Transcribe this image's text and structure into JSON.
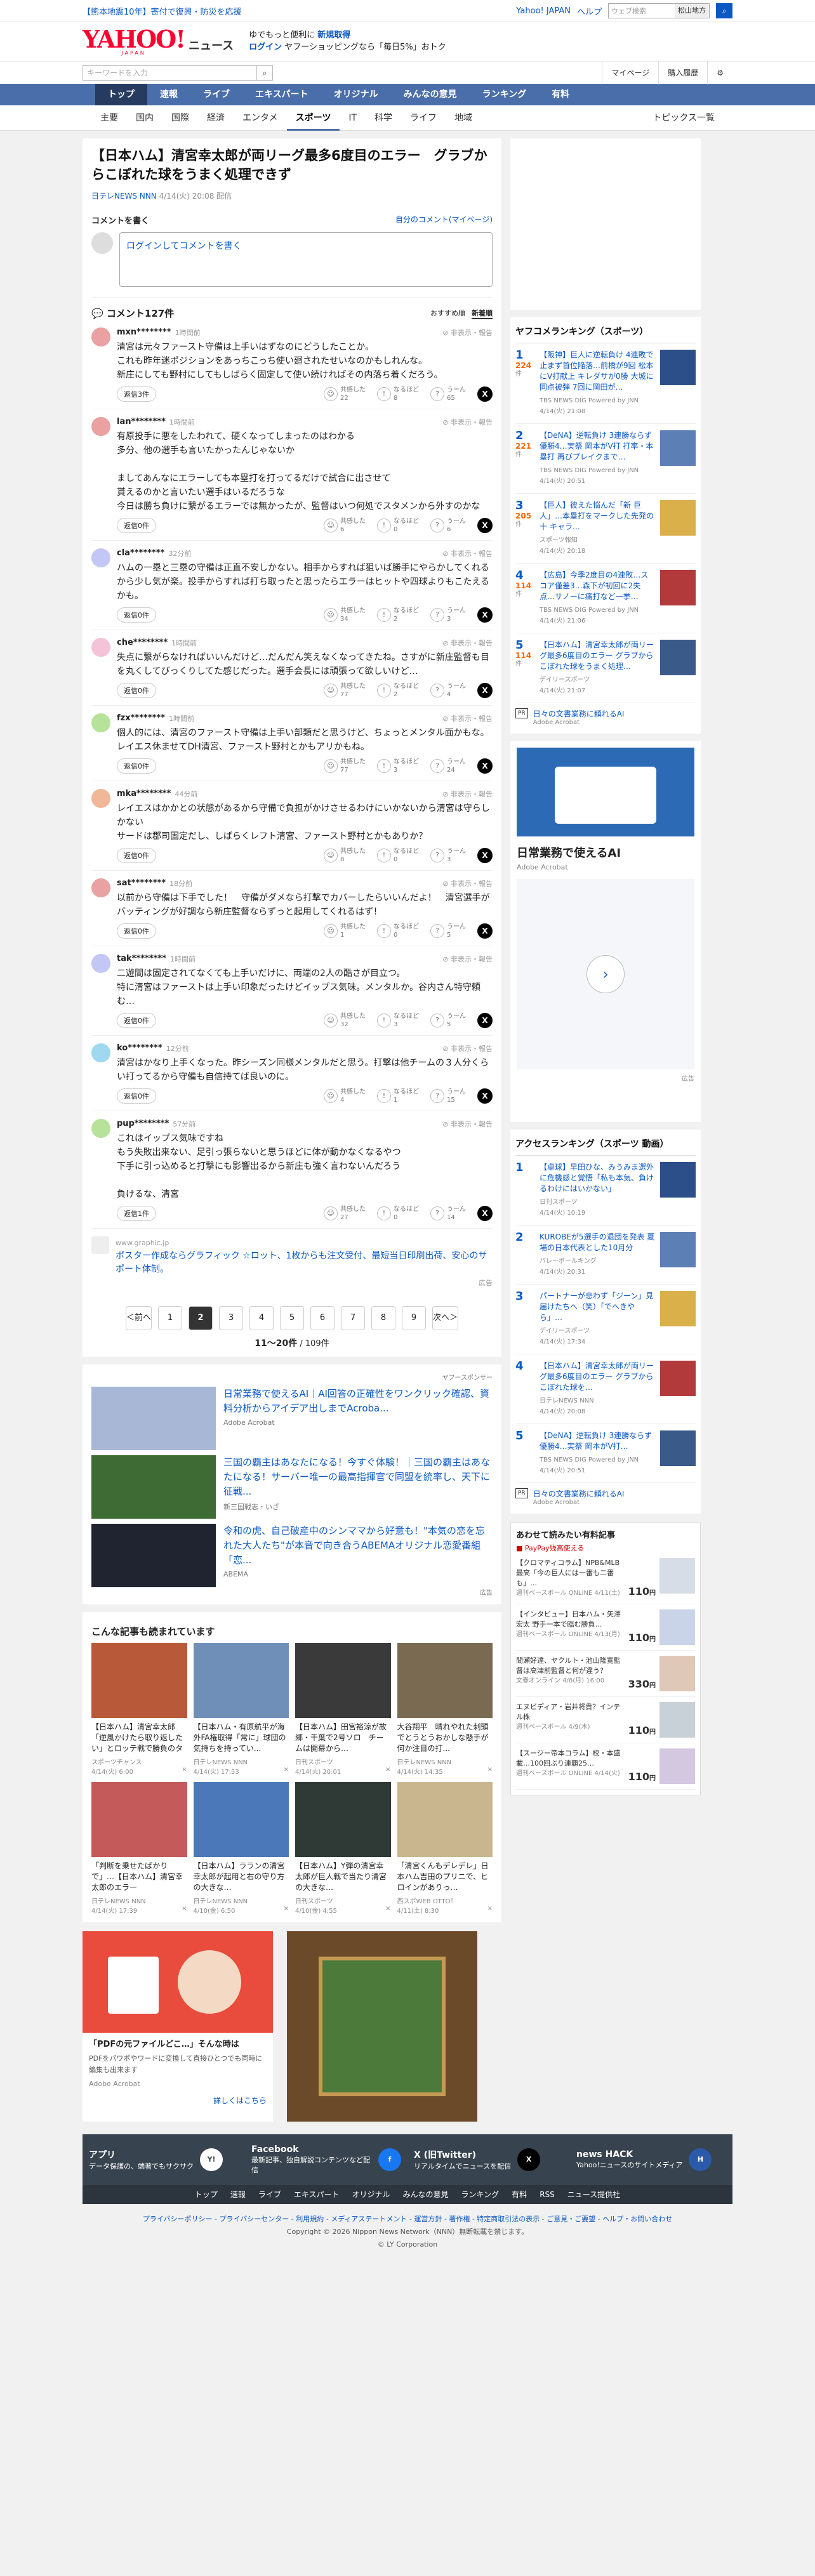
{
  "topbar": {
    "left": "【熊本地震10年】寄付で復興・防災を応援",
    "right": [
      "Yahoo! JAPAN",
      "ヘルプ"
    ],
    "search_placeholder": "ウェブ検索",
    "city": "松山地方"
  },
  "header": {
    "logo": "YAHOO!",
    "logo_sub": "JAPAN",
    "news": "ニュース",
    "promo1": "ゆでもっと便利に",
    "promo1b": "新規取得",
    "promo2": "ログイン",
    "promo2b": "ヤフーショッピングなら「毎日5%」おトク"
  },
  "searchrow": {
    "placeholder": "キーワードを入力",
    "util": [
      "マイページ",
      "購入履歴"
    ]
  },
  "nav1": [
    "トップ",
    "速報",
    "ライブ",
    "エキスパート",
    "オリジナル",
    "みんなの意見",
    "ランキング",
    "有料"
  ],
  "nav2": [
    "主要",
    "国内",
    "国際",
    "経済",
    "エンタメ",
    "スポーツ",
    "IT",
    "科学",
    "ライフ",
    "地域"
  ],
  "nav2_right": "トピックス一覧",
  "article": {
    "title": "【日本ハム】清宮幸太郎が両リーグ最多6度目のエラー　グラブからこぼれた球をうまく処理できず",
    "source": "日テレNEWS NNN",
    "date": "4/14(火) 20:08 配信"
  },
  "compose": {
    "heading": "コメントを書く",
    "mine": "自分のコメント(マイページ)",
    "prompt": "ログインしてコメントを書く"
  },
  "comments_head": {
    "count": "コメント127件",
    "sort1": "おすすめ順",
    "sort2": "新着順"
  },
  "reaction_labels": [
    "共感した",
    "なるほど",
    "うーん"
  ],
  "comments": [
    {
      "user": "mxn********",
      "time": "1時間前",
      "text": "清宮は元々ファースト守備は上手いはずなのにどうしたことか。\nこれも昨年迷ポジションをあっちこっち使い廻されたせいなのかもしれんな。\n新庄にしても野村にしてもしばらく固定して使い続ければその内落ち着くだろう。",
      "reply": "返信3件",
      "r": [
        22,
        8,
        65
      ],
      "av": "#e9a1a1"
    },
    {
      "user": "lan********",
      "time": "1時間前",
      "text": "有原投手に悪をしたわれて、硬くなってしまったのはわかる\n多分、他の選手も言いたかったんじゃないか\n\nましてあんなにエラーしても本塁打を打ってるだけで試合に出させて\n貰えるのかと言いたい選手はいるだろうな\n今日は勝ち負けに繋がるエラーでは無かったが、監督はいつ何処でスタメンから外すのかな",
      "reply": "返信0件",
      "r": [
        6,
        0,
        6
      ],
      "av": "#e9a1a1"
    },
    {
      "user": "cla********",
      "time": "32分前",
      "text": "ハムの一塁と三塁の守備は正直不安しかない。相手からすれば狙いば勝手にやらかしてくれるから少し気が楽。投手からすれば打ち取ったと思ったらエラーはヒットや四球よりもこたえるかも。",
      "reply": "返信0件",
      "r": [
        34,
        2,
        3
      ],
      "av": "#c3c7f5"
    },
    {
      "user": "che********",
      "time": "1時間前",
      "text": "失点に繋がらなければいいんだけど…だんだん笑えなくなってきたね。さすがに新庄監督も目を丸くしてびっくりしてた感じだった。選手会長には頑張って欲しいけど…",
      "reply": "返信0件",
      "r": [
        77,
        2,
        4
      ],
      "av": "#f5c3d7"
    },
    {
      "user": "fzx********",
      "time": "1時間前",
      "text": "個人的には、清宮のファースト守備は上手い部類だと思うけど、ちょっとメンタル面かもな。レイエス休ませてDH清宮、ファースト野村とかもアリかもね。",
      "reply": "返信0件",
      "r": [
        77,
        3,
        24
      ],
      "av": "#b7e29a"
    },
    {
      "user": "mka********",
      "time": "44分前",
      "text": "レイエスはかかとの状態があるから守備で負担がかけさせるわけにいかないから清宮は守らしかない\nサードは郡司固定だし、しばらくレフト清宮、ファースト野村とかもありか？",
      "reply": "返信0件",
      "r": [
        8,
        0,
        3
      ],
      "av": "#f0b896"
    },
    {
      "user": "sat********",
      "time": "18分前",
      "text": "以前から守備は下手でした！　守備がダメなら打撃でカバーしたらいいんだよ！　清宮選手がバッティングが好調なら新庄監督ならずっと起用してくれるはず！",
      "reply": "返信0件",
      "r": [
        1,
        0,
        5
      ],
      "av": "#e9a1a1"
    },
    {
      "user": "tak********",
      "time": "1時間前",
      "text": "二遊間は固定されてなくても上手いだけに、両端の2人の酷さが目立つ。\n特に清宮はファーストは上手い印象だったけどイップス気味。メンタルか。谷内さん特守頼む…",
      "reply": "返信0件",
      "r": [
        32,
        3,
        5
      ],
      "av": "#c3c7f5"
    },
    {
      "user": "ko********",
      "time": "12分前",
      "text": "清宮はかなり上手くなった。昨シーズン同様メンタルだと思う。打撃は他チームの３人分くらい打ってるから守備も自信持てば良いのに。",
      "reply": "返信0件",
      "r": [
        4,
        1,
        15
      ],
      "av": "#9fd8ef"
    },
    {
      "user": "pup********",
      "time": "57分前",
      "text": "これはイップス気味ですね\nもう失敗出来ない、足引っ張らないと思うほどに体が動かなくなるやつ\n下手に引っ込めると打撃にも影響出るから新庄も強く言わないんだろう\n\n負けるな、清宮",
      "reply": "返信1件",
      "r": [
        27,
        0,
        14
      ],
      "av": "#b7e29a"
    }
  ],
  "inline_ad": {
    "domain": "www.graphic.jp",
    "text": "ポスター作成ならグラフィック ☆ロット、1枚からも注文受付、最短当日印刷出荷、安心のサポート体制。",
    "label": "広告"
  },
  "pagination": {
    "prev": "＜前へ",
    "pages": [
      "1",
      "2",
      "3",
      "4",
      "5",
      "6",
      "7",
      "8",
      "9"
    ],
    "current": "2",
    "next": "次へ＞",
    "range": "11〜20件",
    "total": "109件"
  },
  "sponsored": {
    "label": "ヤフースポンサー",
    "items": [
      {
        "title": "日常業務で使えるAI｜AI回答の正確性をワンクリック確認、資料分析からアイデア出しまでAcroba...",
        "source": "Adobe Acrobat"
      },
      {
        "title": "三国の覇主はあなたになる！今すぐ体験！｜三国の覇主はあなたになる！サーバー唯一の最高指揮官で同盟を統率し、天下に征戦...",
        "source": "新三国戦志・いざ"
      },
      {
        "title": "令和の虎、自己破産中のシンママから好意も！\"本気の恋を忘れた大人たち\"が本音で向き合うABEMAオリジナル恋愛番組「恋...",
        "source": "ABEMA"
      }
    ],
    "ad_label": "広告"
  },
  "related": {
    "heading": "こんな記事も読まれています",
    "items": [
      {
        "title": "【日本ハム】清宮幸太郎「逆風かけたら取り返したい」とロッテ戦で勝負のタイミング",
        "source": "スポーツチャンス",
        "date": "4/14(火) 6:00",
        "c": "#b85a3a"
      },
      {
        "title": "【日本ハム・有原航平が海外FA権取得「常に」球団の気持ちを持ってい...",
        "source": "日テレNEWS NNN",
        "date": "4/14(火) 17:53",
        "c": "#6f8fb8"
      },
      {
        "title": "【日本ハム】田宮裕涼が故郷・千葉で2号ソロ　チームは開幕から…",
        "source": "日刊スポーツ",
        "date": "4/14(火) 20:01",
        "c": "#3a3a3a"
      },
      {
        "title": "大谷翔平　晴れやれた刺頭でとうとうおかしな懸手が何か注目の打...",
        "source": "日テレNEWS NNN",
        "date": "4/14(火) 14:35",
        "c": "#7a6a52"
      },
      {
        "title": "「判断を乗せたばかりで」…【日本ハム】清宮幸太郎のエラー",
        "source": "日テレNEWS NNN",
        "date": "4/14(火) 17:39",
        "c": "#c55a5a"
      },
      {
        "title": "【日本ハム】ラランの清宮幸太郎が起用と右の守り方の大きな…",
        "source": "日テレNEWS NNN",
        "date": "4/10(金) 6:50",
        "c": "#4b78b8"
      },
      {
        "title": "【日本ハム】Y弾の清宮幸太郎が巨人戦で当たり清宮の大きな…",
        "source": "日刊スポーツ",
        "date": "4/10(金) 4:55",
        "c": "#2f3a36"
      },
      {
        "title": "「清宮くんもデレデレ」日本ハム吉田のプリニで、ヒロインがありっ…",
        "source": "西スポWEB OTTO！",
        "date": "4/11(土) 8:30",
        "c": "#c9b58e"
      }
    ]
  },
  "promo_ads": {
    "left_title": "「PDFの元ファイルどこ…」そんな時は",
    "left_text": "PDFをパワポやワードに変換して直接ひとつでも同時に編集も出来ます",
    "left_source": "Adobe Acrobat",
    "left_btn": "詳しくはこちら"
  },
  "right": {
    "ranking1_title": "ヤフコメランキング（スポーツ）",
    "ranking1": [
      {
        "n": "1",
        "cnt": "224",
        "title": "【阪神】巨人に逆転負け 4連敗で止まず首位陥落…前橋が9回 松本にV打献上 キレダサが0勝 大城に同点被弾 7回に岡田が…",
        "meta": "TBS NEWS DIG Powered by JNN",
        "date": "4/14(火) 21:08"
      },
      {
        "n": "2",
        "cnt": "221",
        "title": "【DeNA】逆転負け 3連勝ならず優勝4…実祭 岡本がV打 打率・本塁打 再びブレイクまで…",
        "meta": "TBS NEWS DIG Powered by JNN",
        "date": "4/14(火) 20:51"
      },
      {
        "n": "3",
        "cnt": "205",
        "title": "【巨人】彼えた悩んだ「新 巨人」…本塁打をマークした先発の十 キャラ…",
        "meta": "スポーツ報知",
        "date": "4/14(火) 20:18"
      },
      {
        "n": "4",
        "cnt": "114",
        "title": "【広島】今季2度目の4連敗…スコア僅差3…森下が初回に2失点…サノーに痛打など一挙…",
        "meta": "TBS NEWS DIG Powered by JNN",
        "date": "4/14(火) 21:06"
      },
      {
        "n": "5",
        "cnt": "114",
        "title": "【日本ハム】清宮幸太郎が両リーグ最多6度目のエラー グラブからこぼれた球をうまく処理…",
        "meta": "デイリースポーツ",
        "date": "4/14(火) 21:07"
      }
    ],
    "pr1": "日々の文書業務に頼れるAI",
    "pr1_src": "Adobe Acrobat",
    "ad_title": "日常業務で使えるAI",
    "ad_src": "Adobe Acrobat",
    "ad_label": "広告",
    "ranking2_title": "アクセスランキング（スポーツ 動画）",
    "ranking2": [
      {
        "n": "1",
        "title": "【卓球】早田ひな、みうみま選外に危機感と覚悟「私も本気、負けるわけにはいかない」",
        "meta": "日刊スポーツ",
        "date": "4/14(火) 10:19"
      },
      {
        "n": "2",
        "title": "KUROBEが5選手の退団を発表 夏場の日本代表とした10月分",
        "meta": "バレーボールキング",
        "date": "4/14(火) 20:31"
      },
      {
        "n": "3",
        "title": "パートナーが悲わず「ジーン」見届けたちへ（笑）「でへきやら」…",
        "meta": "デイリースポーツ",
        "date": "4/14(火) 17:34"
      },
      {
        "n": "4",
        "title": "【日本ハム】清宮幸太郎が両リーグ最多6度目のエラー グラブからこぼれた球を…",
        "meta": "日テレNEWS NNN",
        "date": "4/14(火) 20:08"
      },
      {
        "n": "5",
        "title": "【DeNA】逆転負け 3連勝ならず優勝4…実祭 岡本がV打…",
        "meta": "TBS NEWS DIG Powered by JNN",
        "date": "4/14(火) 20:51"
      }
    ],
    "pr2": "日々の文書業務に頼れるAI",
    "pr2_src": "Adobe Acrobat",
    "paypay_title": "あわせて読みたい有料記事",
    "paypay_sub": "PayPay残高使える",
    "paypay": [
      {
        "title": "【クロマティコラム】NPB&MLB最高「今の巨人には一番も二番も」…",
        "src": "週刊ベースボール ONLINE 4/11(土)",
        "price": "110"
      },
      {
        "title": "【インタビュー】日本ハム・矢澤宏太 野手一本で臨む勝負…",
        "src": "週刊ベースボール ONLINE 4/13(月)",
        "price": "110"
      },
      {
        "title": "間瀬好達、ヤクルト・池山隆寛監督は高津前監督と何が違う？",
        "src": "文春オンライン 4/6(月) 16:00",
        "price": "330"
      },
      {
        "title": "エヌビディア・岩井将貴？インテル株",
        "src": "週刊ベースボール 4/9(木)",
        "price": "110"
      },
      {
        "title": "【スージー帝本コラム】校・本盛載…100回ぶり連覇25…",
        "src": "週刊ベースボール ONLINE 4/14(火)",
        "price": "110"
      }
    ],
    "yen": "円"
  },
  "footer": {
    "apps": [
      {
        "name": "アプリ",
        "desc": "データ保護の、端著でもサクサク"
      },
      {
        "name": "Facebook",
        "desc": "最新記事、独自解説コンテンツなど配信"
      },
      {
        "name": "X (旧Twitter)",
        "desc": "リアルタイムでニュースを配信"
      },
      {
        "name": "news HACK",
        "desc": "Yahoo!ニュースのサイトメディア"
      }
    ],
    "nav": [
      "トップ",
      "速報",
      "ライブ",
      "エキスパート",
      "オリジナル",
      "みんなの意見",
      "ランキング",
      "有料",
      "RSS",
      "ニュース提供社"
    ],
    "links": "プライバシーポリシー - プライバシーセンター - 利用規約 - メディアステートメント - 運営方針 - 著作権 - 特定商取引法の表示 - ご意見・ご要望 - ヘルプ・お問い合わせ",
    "copy1": "Copyright © 2026 Nippon News Network（NNN）無断転載を禁じます。",
    "copy2": "© LY Corporation"
  }
}
